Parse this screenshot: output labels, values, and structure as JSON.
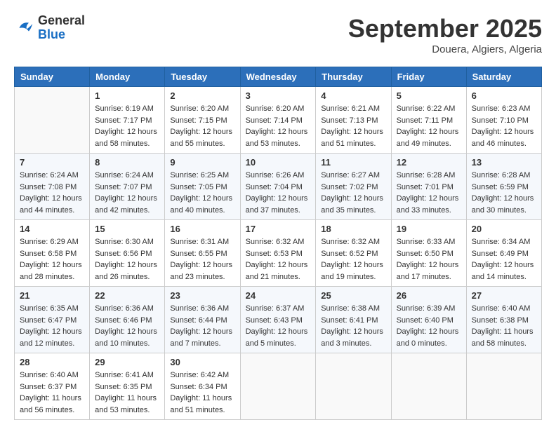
{
  "header": {
    "logo_general": "General",
    "logo_blue": "Blue",
    "title": "September 2025",
    "subtitle": "Douera, Algiers, Algeria"
  },
  "weekdays": [
    "Sunday",
    "Monday",
    "Tuesday",
    "Wednesday",
    "Thursday",
    "Friday",
    "Saturday"
  ],
  "weeks": [
    [
      {
        "day": "",
        "sunrise": "",
        "sunset": "",
        "daylight": ""
      },
      {
        "day": "1",
        "sunrise": "6:19 AM",
        "sunset": "7:17 PM",
        "daylight": "12 hours and 58 minutes."
      },
      {
        "day": "2",
        "sunrise": "6:20 AM",
        "sunset": "7:15 PM",
        "daylight": "12 hours and 55 minutes."
      },
      {
        "day": "3",
        "sunrise": "6:20 AM",
        "sunset": "7:14 PM",
        "daylight": "12 hours and 53 minutes."
      },
      {
        "day": "4",
        "sunrise": "6:21 AM",
        "sunset": "7:13 PM",
        "daylight": "12 hours and 51 minutes."
      },
      {
        "day": "5",
        "sunrise": "6:22 AM",
        "sunset": "7:11 PM",
        "daylight": "12 hours and 49 minutes."
      },
      {
        "day": "6",
        "sunrise": "6:23 AM",
        "sunset": "7:10 PM",
        "daylight": "12 hours and 46 minutes."
      }
    ],
    [
      {
        "day": "7",
        "sunrise": "6:24 AM",
        "sunset": "7:08 PM",
        "daylight": "12 hours and 44 minutes."
      },
      {
        "day": "8",
        "sunrise": "6:24 AM",
        "sunset": "7:07 PM",
        "daylight": "12 hours and 42 minutes."
      },
      {
        "day": "9",
        "sunrise": "6:25 AM",
        "sunset": "7:05 PM",
        "daylight": "12 hours and 40 minutes."
      },
      {
        "day": "10",
        "sunrise": "6:26 AM",
        "sunset": "7:04 PM",
        "daylight": "12 hours and 37 minutes."
      },
      {
        "day": "11",
        "sunrise": "6:27 AM",
        "sunset": "7:02 PM",
        "daylight": "12 hours and 35 minutes."
      },
      {
        "day": "12",
        "sunrise": "6:28 AM",
        "sunset": "7:01 PM",
        "daylight": "12 hours and 33 minutes."
      },
      {
        "day": "13",
        "sunrise": "6:28 AM",
        "sunset": "6:59 PM",
        "daylight": "12 hours and 30 minutes."
      }
    ],
    [
      {
        "day": "14",
        "sunrise": "6:29 AM",
        "sunset": "6:58 PM",
        "daylight": "12 hours and 28 minutes."
      },
      {
        "day": "15",
        "sunrise": "6:30 AM",
        "sunset": "6:56 PM",
        "daylight": "12 hours and 26 minutes."
      },
      {
        "day": "16",
        "sunrise": "6:31 AM",
        "sunset": "6:55 PM",
        "daylight": "12 hours and 23 minutes."
      },
      {
        "day": "17",
        "sunrise": "6:32 AM",
        "sunset": "6:53 PM",
        "daylight": "12 hours and 21 minutes."
      },
      {
        "day": "18",
        "sunrise": "6:32 AM",
        "sunset": "6:52 PM",
        "daylight": "12 hours and 19 minutes."
      },
      {
        "day": "19",
        "sunrise": "6:33 AM",
        "sunset": "6:50 PM",
        "daylight": "12 hours and 17 minutes."
      },
      {
        "day": "20",
        "sunrise": "6:34 AM",
        "sunset": "6:49 PM",
        "daylight": "12 hours and 14 minutes."
      }
    ],
    [
      {
        "day": "21",
        "sunrise": "6:35 AM",
        "sunset": "6:47 PM",
        "daylight": "12 hours and 12 minutes."
      },
      {
        "day": "22",
        "sunrise": "6:36 AM",
        "sunset": "6:46 PM",
        "daylight": "12 hours and 10 minutes."
      },
      {
        "day": "23",
        "sunrise": "6:36 AM",
        "sunset": "6:44 PM",
        "daylight": "12 hours and 7 minutes."
      },
      {
        "day": "24",
        "sunrise": "6:37 AM",
        "sunset": "6:43 PM",
        "daylight": "12 hours and 5 minutes."
      },
      {
        "day": "25",
        "sunrise": "6:38 AM",
        "sunset": "6:41 PM",
        "daylight": "12 hours and 3 minutes."
      },
      {
        "day": "26",
        "sunrise": "6:39 AM",
        "sunset": "6:40 PM",
        "daylight": "12 hours and 0 minutes."
      },
      {
        "day": "27",
        "sunrise": "6:40 AM",
        "sunset": "6:38 PM",
        "daylight": "11 hours and 58 minutes."
      }
    ],
    [
      {
        "day": "28",
        "sunrise": "6:40 AM",
        "sunset": "6:37 PM",
        "daylight": "11 hours and 56 minutes."
      },
      {
        "day": "29",
        "sunrise": "6:41 AM",
        "sunset": "6:35 PM",
        "daylight": "11 hours and 53 minutes."
      },
      {
        "day": "30",
        "sunrise": "6:42 AM",
        "sunset": "6:34 PM",
        "daylight": "11 hours and 51 minutes."
      },
      {
        "day": "",
        "sunrise": "",
        "sunset": "",
        "daylight": ""
      },
      {
        "day": "",
        "sunrise": "",
        "sunset": "",
        "daylight": ""
      },
      {
        "day": "",
        "sunrise": "",
        "sunset": "",
        "daylight": ""
      },
      {
        "day": "",
        "sunrise": "",
        "sunset": "",
        "daylight": ""
      }
    ]
  ]
}
